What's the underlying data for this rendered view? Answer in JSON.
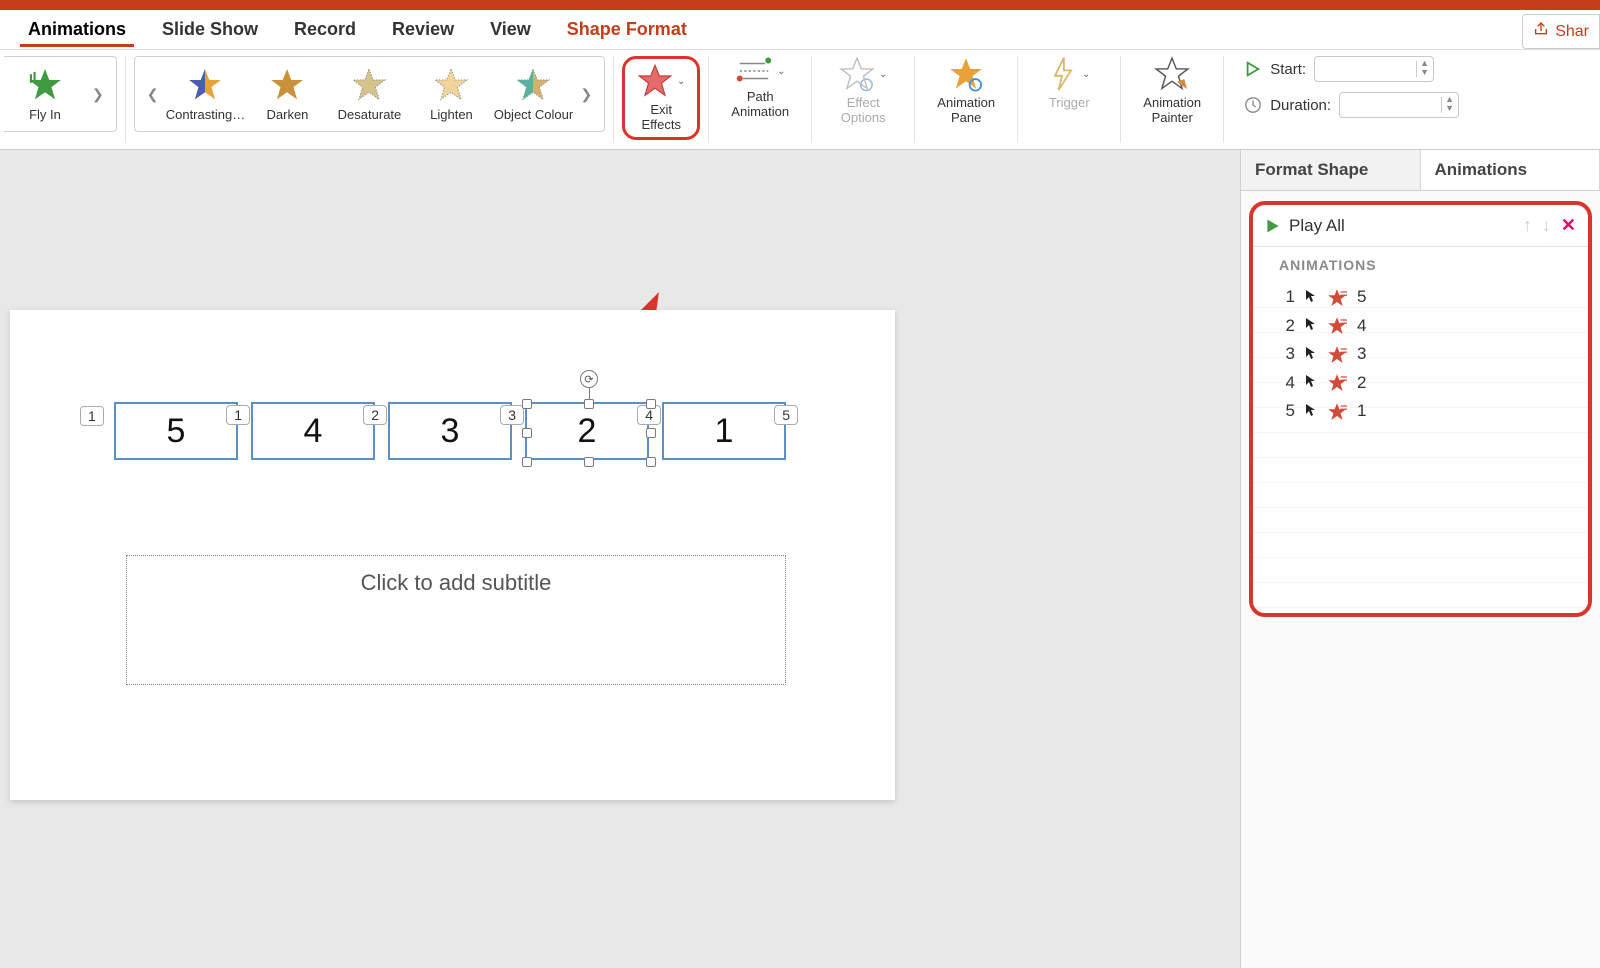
{
  "tabs": {
    "animations": "Animations",
    "slide_show": "Slide Show",
    "record": "Record",
    "review": "Review",
    "view": "View",
    "shape_format": "Shape Format"
  },
  "share_label": "Shar",
  "entrance_gallery": {
    "fly_in": "Fly In"
  },
  "emphasis_gallery": [
    "Contrasting…",
    "Darken",
    "Desaturate",
    "Lighten",
    "Object Colour"
  ],
  "ribbon_buttons": {
    "exit_effects": "Exit\nEffects",
    "path_animation": "Path\nAnimation",
    "effect_options": "Effect\nOptions",
    "animation_pane": "Animation\nPane",
    "trigger": "Trigger",
    "animation_painter": "Animation\nPainter"
  },
  "timing": {
    "start_label": "Start:",
    "duration_label": "Duration:",
    "start_value": "",
    "duration_value": ""
  },
  "slide": {
    "thumb_index": "1",
    "shapes": [
      {
        "text": "5",
        "order": "1"
      },
      {
        "text": "4",
        "order": "2"
      },
      {
        "text": "3",
        "order": "3"
      },
      {
        "text": "2",
        "order": "4"
      },
      {
        "text": "1",
        "order": "5"
      }
    ],
    "subtitle_placeholder": "Click to add subtitle"
  },
  "right_panel": {
    "tab_format_shape": "Format Shape",
    "tab_animations": "Animations",
    "play_all": "Play All",
    "list_header": "ANIMATIONS",
    "items": [
      {
        "order": "1",
        "target": "5"
      },
      {
        "order": "2",
        "target": "4"
      },
      {
        "order": "3",
        "target": "3"
      },
      {
        "order": "4",
        "target": "2"
      },
      {
        "order": "5",
        "target": "1"
      }
    ]
  },
  "colors": {
    "accent": "#c43e1c",
    "highlight": "#d9352c",
    "shape_border": "#5b8fc7"
  }
}
